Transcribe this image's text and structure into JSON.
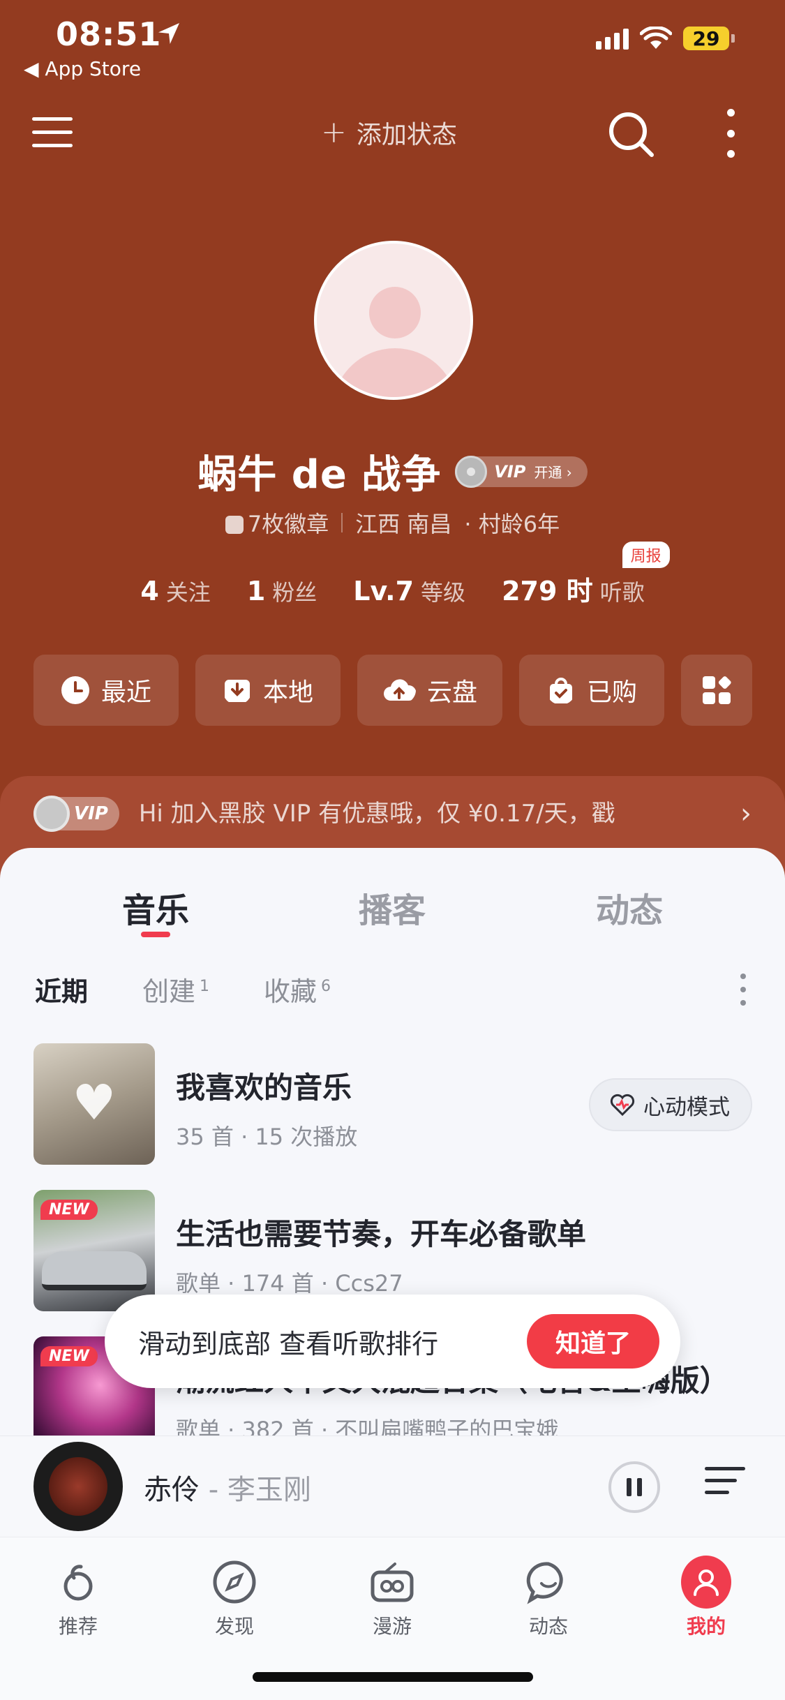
{
  "status_bar": {
    "time": "08:51",
    "back_app": "◀ App Store",
    "battery": "29"
  },
  "header": {
    "add_status_label": "添加状态"
  },
  "profile": {
    "name": "蜗牛 de 战争",
    "vip_label": "VIP",
    "vip_open": "开通 ›",
    "badges": "7枚徽章",
    "location": "江西 南昌",
    "village_age": "· 村龄6年",
    "stats": {
      "follow_num": "4",
      "follow_label": "关注",
      "fans_num": "1",
      "fans_label": "粉丝",
      "level_num": "Lv.7",
      "level_label": "等级",
      "hours_num": "279 时",
      "hours_label": "听歌",
      "weekly_tag": "周报"
    }
  },
  "quick_actions": [
    {
      "label": "最近"
    },
    {
      "label": "本地"
    },
    {
      "label": "云盘"
    },
    {
      "label": "已购"
    }
  ],
  "vip_banner": {
    "badge": "VIP",
    "text": "Hi 加入黑胶 VIP 有优惠哦，仅 ¥0.17/天，戳",
    "arrow": "›"
  },
  "main_tabs": [
    "音乐",
    "播客",
    "动态"
  ],
  "sub_tabs": {
    "recent": "近期",
    "created": "创建",
    "created_count": "1",
    "collected": "收藏",
    "collected_count": "6"
  },
  "playlists": [
    {
      "title": "我喜欢的音乐",
      "subtitle": "35 首 · 15 次播放",
      "action": "心动模式"
    },
    {
      "title": "生活也需要节奏，开车必备歌单",
      "subtitle": "歌单 · 174 首 · Ccs27",
      "tag": "NEW"
    },
    {
      "title": "潮流红人中文大混超合集（电音&土嗨版）",
      "subtitle": "歌单 · 382 首 · 不叫扁嘴鸭子的巴宝娥",
      "tag": "NEW"
    }
  ],
  "toast": {
    "text": "滑动到底部 查看听歌排行",
    "button": "知道了"
  },
  "player": {
    "song": "赤伶",
    "artist": " - 李玉刚"
  },
  "tabbar": [
    {
      "label": "推荐"
    },
    {
      "label": "发现"
    },
    {
      "label": "漫游"
    },
    {
      "label": "动态"
    },
    {
      "label": "我的"
    }
  ],
  "colors": {
    "header_bg": "#933b20",
    "accent": "#f03c4e",
    "panel_bg": "#f6f7fb"
  }
}
